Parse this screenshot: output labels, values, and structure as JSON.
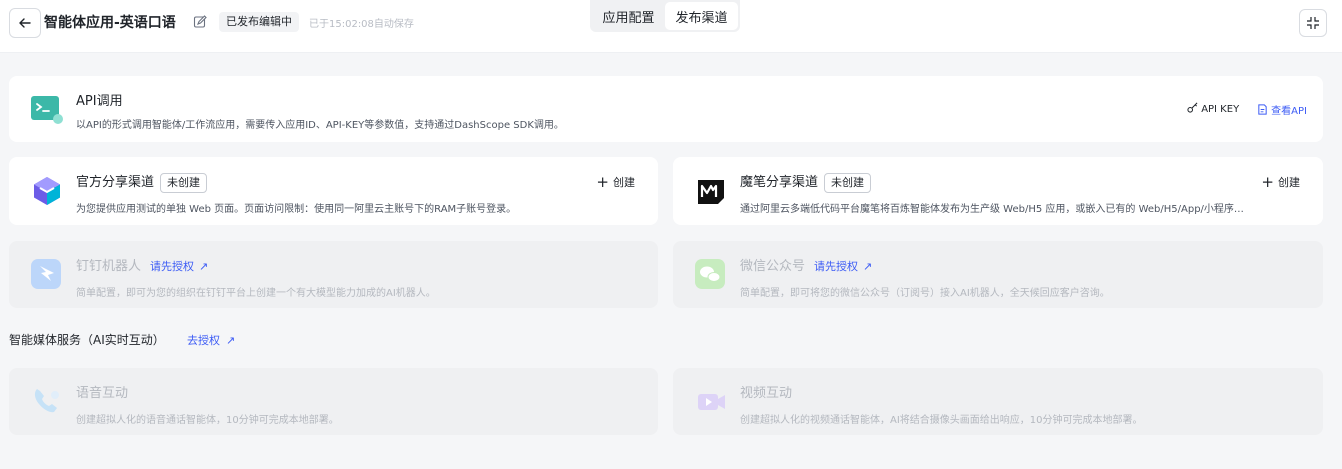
{
  "header": {
    "title": "智能体应用-英语口语",
    "status_badge": "已发布编辑中",
    "autosave_text": "已于15:02:08自动保存",
    "tabs": [
      {
        "label": "应用配置",
        "active": false
      },
      {
        "label": "发布渠道",
        "active": true
      }
    ]
  },
  "api_card": {
    "title": "API调用",
    "description": "以API的形式调用智能体/工作流应用，需要传入应用ID、API-KEY等参数值，支持通过DashScope SDK调用。",
    "api_key_label": "API KEY",
    "view_api_label": "查看API"
  },
  "channels": [
    {
      "title": "官方分享渠道",
      "tag": "未创建",
      "action": "创建",
      "description": "为您提供应用测试的单独 Web 页面。页面访问限制：使用同一阿里云主账号下的RAM子账号登录。"
    },
    {
      "title": "魔笔分享渠道",
      "tag": "未创建",
      "action": "创建",
      "description": "通过阿里云多端低代码平台魔笔将百炼智能体发布为生产级 Web/H5 应用，或嵌入已有的 Web/H5/App/小程序…"
    },
    {
      "title": "钉钉机器人",
      "auth_link": "请先授权",
      "description": "简单配置，即可为您的组织在钉钉平台上创建一个有大模型能力加成的AI机器人。"
    },
    {
      "title": "微信公众号",
      "auth_link": "请先授权",
      "description": "简单配置，即可将您的微信公众号（订阅号）接入AI机器人，全天候回应客户咨询。"
    }
  ],
  "media_section": {
    "title": "智能媒体服务（AI实时互动）",
    "auth_link": "去授权",
    "items": [
      {
        "title": "语音互动",
        "description": "创建超拟人化的语音通话智能体，10分钟可完成本地部署。"
      },
      {
        "title": "视频互动",
        "description": "创建超拟人化的视频通话智能体，AI将结合摄像头画面给出响应，10分钟可完成本地部署。"
      }
    ]
  },
  "colors": {
    "link": "#3d5cf5",
    "api_icon": "#3cb8a8",
    "dingtalk_icon": "#7fb3f5",
    "wechat_icon": "#8fd87f",
    "voice_icon": "#9fcdf0",
    "video_icon": "#c9b9f2"
  },
  "icons": {
    "back": "arrow-left-icon",
    "edit": "edit-icon",
    "collapse": "collapse-icon",
    "api": "terminal-icon",
    "api_key": "key-icon",
    "view_api": "document-icon",
    "official": "cube-logo-icon",
    "mobi": "mobi-logo-icon",
    "dingtalk": "dingtalk-icon",
    "wechat": "wechat-icon",
    "voice": "phone-icon",
    "video": "video-icon"
  }
}
